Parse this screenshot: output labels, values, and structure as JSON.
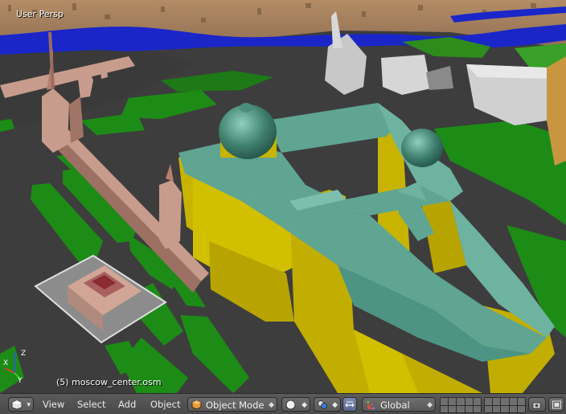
{
  "viewport": {
    "perspective_label": "User Persp",
    "object_label": "(5) moscow_center.osm",
    "axes": {
      "x_label": "X",
      "y_label": "Y",
      "z_label": "Z"
    }
  },
  "header": {
    "editor_type_icon": "3d-view-icon",
    "menus": [
      "View",
      "Select",
      "Add",
      "Object"
    ],
    "mode": {
      "label": "Object Mode",
      "icon": "object-mode-cube-icon"
    },
    "shading_icon": "solid-sphere-icon",
    "pivot_icon": "pivot-point-icon",
    "manipulator_icon": "manipulator-arrows-icon",
    "orientation": {
      "label": "Global",
      "icon": "transform-orientation-icon"
    },
    "layers_label_count": 20,
    "right_icons": [
      "lock-camera-icon",
      "render-preview-icon"
    ]
  },
  "colors": {
    "building_yellow": "#c8b400",
    "roof_green": "#5fa592",
    "grass": "#1d8c16",
    "brick": "#c89c8c",
    "river": "#1a26c8",
    "ground": "#3d3d3d",
    "header_bg": "#4e4e4e"
  }
}
